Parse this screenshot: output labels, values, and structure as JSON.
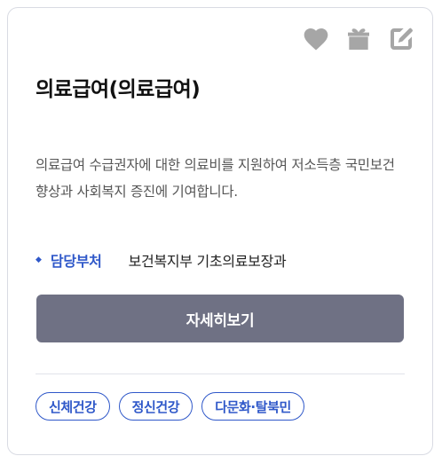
{
  "card": {
    "title": "의료급여(의료급여)",
    "description": "의료급여 수급권자에 대한 의료비를 지원하여 저소득층 국민보건 향상과 사회복지 증진에 기여합니다.",
    "department_label": "담당부처",
    "department_value": "보건복지부 기초의료보장과",
    "detail_button_label": "자세히보기",
    "tags": [
      "신체건강",
      "정신건강",
      "다문화·탈북민"
    ]
  },
  "icons": {
    "favorite": "heart-icon",
    "gift": "gift-icon",
    "edit": "edit-icon"
  },
  "colors": {
    "accent": "#2f58c9",
    "button_bg": "#6f7184",
    "icon_gray": "#a6a6a6"
  }
}
